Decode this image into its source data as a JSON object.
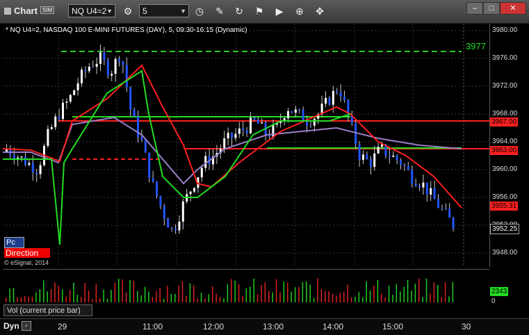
{
  "app": {
    "title": "Chart",
    "sim_badge": "SIM"
  },
  "toolbar": {
    "symbol": "NQ U4=2",
    "interval": "5",
    "icons": [
      "link-icon",
      "clock-icon",
      "pencil-icon",
      "refresh-icon",
      "settings-icon",
      "play-icon",
      "crosshair-icon",
      "tools-icon"
    ]
  },
  "window_controls": {
    "minimize": "–",
    "maximize": "□",
    "close": "✕"
  },
  "chart": {
    "header": "* NQ U4=2, NASDAQ 100 E-MINI FUTURES (DAY), 5, 09:30-16:15 (Dynamic)",
    "price_axis": [
      "3980.00",
      "3976.00",
      "3972.00",
      "3968.00",
      "3964.00",
      "3960.00",
      "3956.00",
      "3952.00",
      "3948.00"
    ],
    "level_3977": "3977",
    "tags": {
      "red1": "3967.00",
      "red2": "3963.00",
      "red3": "3955.31",
      "last": "3952.25"
    },
    "pc_label": "Pc",
    "direction_label": "Direction",
    "copyright": "© eSignal, 2014",
    "ylim": [
      3946,
      3981
    ],
    "colors": {
      "up": "#ffffff",
      "down": "#2255ff",
      "ma_red": "#ff2020",
      "ma_green": "#22dd22",
      "ma_purple": "#9a7fc8",
      "dashed": "#22cc22"
    }
  },
  "volume": {
    "title": "Vol (current price bar)",
    "value": "2343",
    "zero": "0"
  },
  "time_axis": {
    "dyn": "Dyn",
    "labels": [
      "29",
      "11:00",
      "12:00",
      "13:00",
      "14:00",
      "15:00",
      "30"
    ]
  }
}
